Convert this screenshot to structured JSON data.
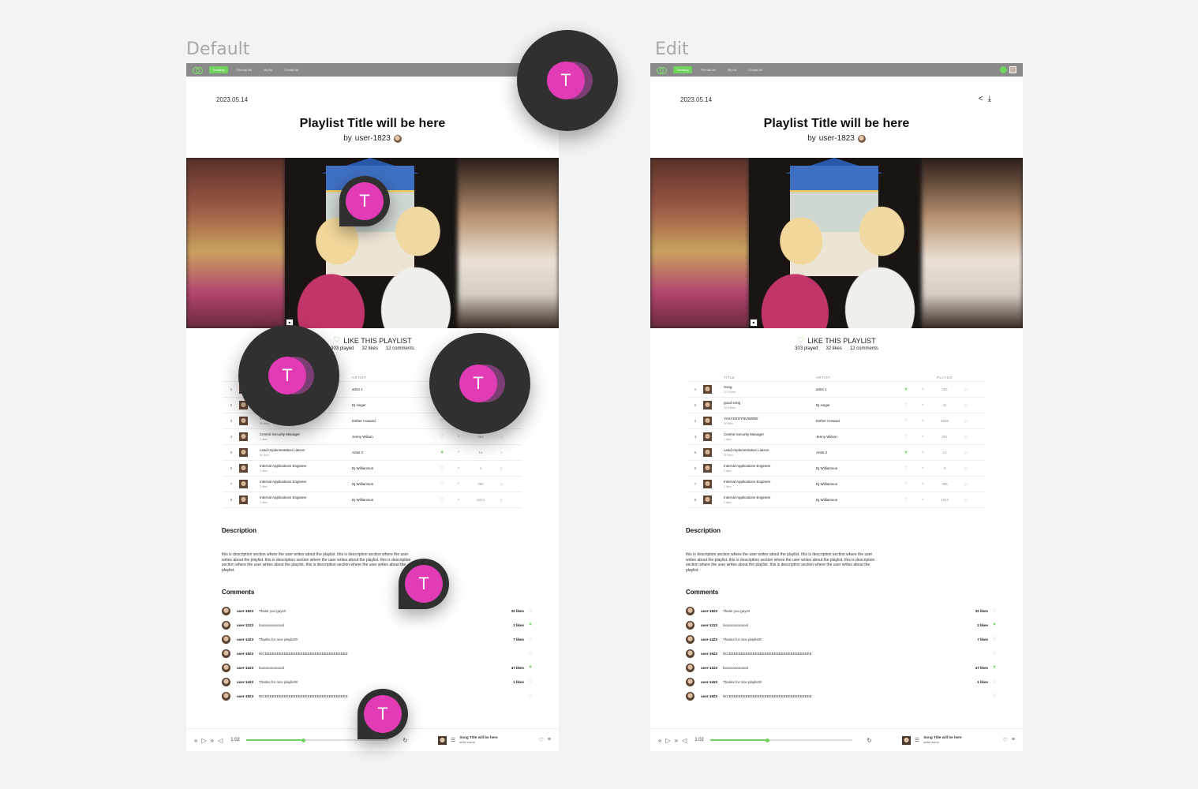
{
  "frames": {
    "default_title": "Default",
    "edit_title": "Edit"
  },
  "nav": {
    "tabs": [
      "Trending",
      "Friends list",
      "My list",
      "Create list"
    ]
  },
  "playlist": {
    "date": "2023.05.14",
    "title": "Playlist Title will be here",
    "by_label": "by",
    "author": "user-1823",
    "like_label": "LIKE THIS PLAYLIST",
    "played": "303 played",
    "likes": "32 likes",
    "comments_count": "12 comments"
  },
  "track_headers": {
    "title": "TITLE",
    "artist": "ARTIST",
    "played": "PLAYED"
  },
  "tracks": [
    {
      "num": "1",
      "title": "Song",
      "sub": "32.5 likes",
      "artist": "artist 1",
      "liked": true,
      "played": "252"
    },
    {
      "num": "2",
      "title": "good song",
      "sub": "32.5 likes",
      "artist": "Dj singer",
      "liked": false,
      "played": "41"
    },
    {
      "num": "3",
      "title": "YASYSKOYNUWWW",
      "sub": "50 likes",
      "artist": "Esther Howard",
      "liked": false,
      "played": "3838"
    },
    {
      "num": "4",
      "title": "Central Security Manager",
      "sub": "1 likes",
      "artist": "Jenny Wilson",
      "liked": false,
      "played": "361"
    },
    {
      "num": "5",
      "title": "Lead Implementation Liaison",
      "sub": "50 likes",
      "artist": "Artist 2",
      "liked": true,
      "played": "12"
    },
    {
      "num": "6",
      "title": "Internal Applications Engineer",
      "sub": "2 likes",
      "artist": "Dj Williamson",
      "liked": false,
      "played": "4"
    },
    {
      "num": "7",
      "title": "Internal Applications Engineer",
      "sub": "2 likes",
      "artist": "Dj Williamson",
      "liked": false,
      "played": "395"
    },
    {
      "num": "8",
      "title": "Internal Applications Engineer",
      "sub": "2 likes",
      "artist": "Dj Williamson",
      "liked": false,
      "played": "1012"
    }
  ],
  "description": {
    "heading": "Description",
    "text": "this is description section where the user writes about the playlist. this is description section where the user writes about the playlist. this is description section where the user writes about the playlist. this is description section where the user writes about the playlist. this is description section where the user writes about the playlist."
  },
  "comments_heading": "Comments",
  "comments": [
    {
      "user": "user-1823",
      "text": "Thank you guys!!",
      "likes": "32 likes",
      "liked": false
    },
    {
      "user": "user-1223",
      "text": "looooooooooool",
      "likes": "2 likes",
      "liked": true
    },
    {
      "user": "user-1423",
      "text": "Thanks for nice playlist!!!",
      "likes": "7 likes",
      "liked": false
    },
    {
      "user": "user-1923",
      "text": "NICEEEEEEEEEEEEEEEEEEEEEEEEEEEEEEEEEEE",
      "likes": "",
      "liked": false
    },
    {
      "user": "user-1223",
      "text": "looooooooooool",
      "likes": "47 likes",
      "liked": true
    },
    {
      "user": "user-1423",
      "text": "Thanks for nice playlist!!!",
      "likes": "1 likes",
      "liked": false
    },
    {
      "user": "user-1923",
      "text": "NICEEEEEEEEEEEEEEEEEEEEEEEEEEEEEEEEEEE",
      "likes": "",
      "liked": false
    }
  ],
  "player": {
    "time": "1:02",
    "song_title": "Song Title will be here",
    "artist": "artist name",
    "progress": 0.4
  },
  "markers": {
    "letter": "T"
  },
  "colors": {
    "accent": "#6fd35d",
    "marker": "#e13bb5",
    "marker_bg": "#303030",
    "nav_bg": "#8a8a8a"
  }
}
